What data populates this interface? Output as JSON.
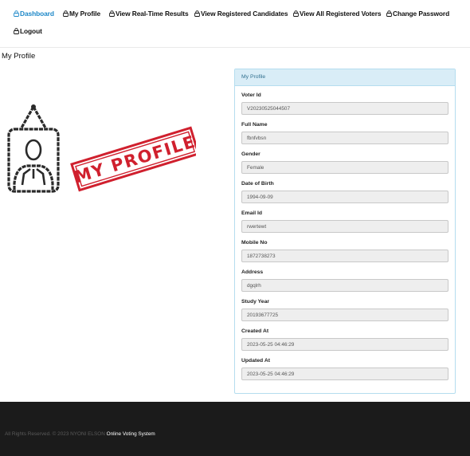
{
  "nav": {
    "items": [
      {
        "label": "Dashboard",
        "active": true,
        "icon": "lock-icon"
      },
      {
        "label": "My Profile",
        "active": false,
        "icon": "lock-icon"
      },
      {
        "label": "View Real-Time Results",
        "active": false,
        "icon": "lock-icon"
      },
      {
        "label": "View Registered Candidates",
        "active": false,
        "icon": "lock-icon"
      },
      {
        "label": "View All Registered Voters",
        "active": false,
        "icon": "lock-icon"
      },
      {
        "label": "Change Password",
        "active": false,
        "icon": "lock-icon"
      },
      {
        "label": "Logout",
        "active": false,
        "icon": "lock-icon"
      }
    ],
    "active_color": "#1e88c8"
  },
  "page": {
    "title": "My Profile"
  },
  "illustration": {
    "stamp_text": "MY PROFILE",
    "stamp_color": "#d0202e"
  },
  "panel": {
    "heading": "My Profile",
    "fields": [
      {
        "label": "Voter Id",
        "value": "V20230525044507"
      },
      {
        "label": "Full Name",
        "value": "fbnfvbsn"
      },
      {
        "label": "Gender",
        "value": "Female"
      },
      {
        "label": "Date of Birth",
        "value": "1994-09-09"
      },
      {
        "label": "Email Id",
        "value": "rwertewt"
      },
      {
        "label": "Mobile No",
        "value": "1872738273"
      },
      {
        "label": "Address",
        "value": "dgqlrh"
      },
      {
        "label": "Study Year",
        "value": "20193677725"
      },
      {
        "label": "Created At",
        "value": "2023-05-25 04:46:29"
      },
      {
        "label": "Updated At",
        "value": "2023-05-25 04:46:29"
      }
    ]
  },
  "footer": {
    "copyright": "All Rights Reserved. © 2023 NYONI ELSON",
    "system_name": "Online Voting System"
  }
}
